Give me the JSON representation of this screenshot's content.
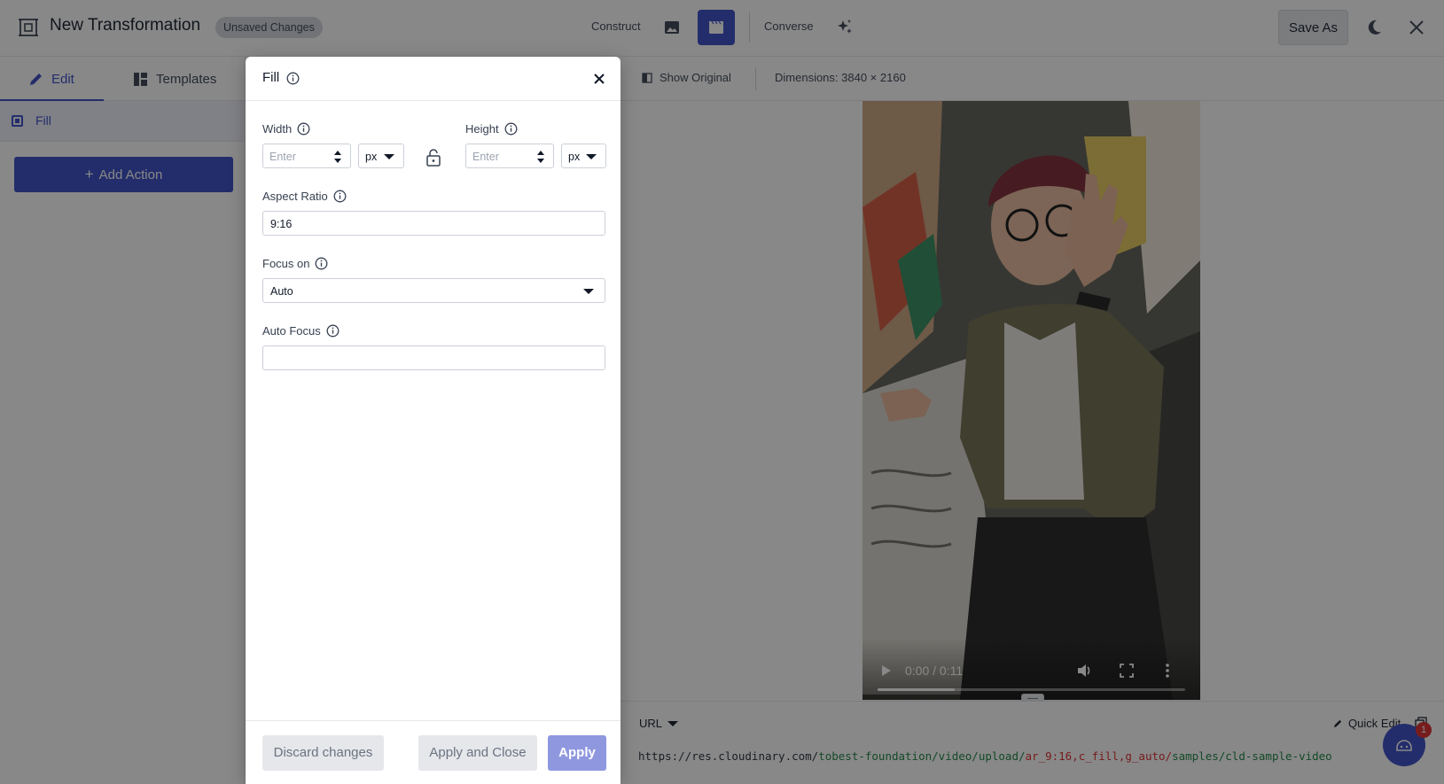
{
  "header": {
    "title": "New Transformation",
    "badge": "Unsaved Changes",
    "construct_label": "Construct",
    "converse_label": "Converse",
    "save_as_label": "Save As"
  },
  "left_panel": {
    "tabs": [
      {
        "label": "Edit",
        "active": true,
        "icon": "pencil-icon"
      },
      {
        "label": "Templates",
        "active": false,
        "icon": "grid-icon"
      }
    ],
    "actions": [
      {
        "label": "Fill"
      }
    ],
    "add_action_label": "Add Action"
  },
  "viewer": {
    "show_original_label": "Show Original",
    "dimensions": "Dimensions: 3840 × 2160",
    "video": {
      "time": "0:00 / 0:11",
      "progress_fraction": 0.25
    }
  },
  "url_bar": {
    "format_label": "URL",
    "quick_edit_label": "Quick Edit",
    "url_base": "https://res.cloudinary.com/",
    "url_cloud": "tobest-foundation/video/upload/",
    "url_transformation": "ar_9:16,c_fill,g_auto/",
    "url_public_id": "samples/cld-sample-video"
  },
  "chat": {
    "count": "1"
  },
  "dialog": {
    "title": "Fill",
    "width": {
      "label": "Width",
      "placeholder": "Enter",
      "unit": "px"
    },
    "height": {
      "label": "Height",
      "placeholder": "Enter",
      "unit": "px"
    },
    "aspect_ratio": {
      "label": "Aspect Ratio",
      "value": "9:16"
    },
    "focus_on": {
      "label": "Focus on",
      "value": "Auto"
    },
    "auto_focus": {
      "label": "Auto Focus",
      "value": ""
    },
    "buttons": {
      "discard": "Discard changes",
      "apply_close": "Apply and Close",
      "apply": "Apply"
    }
  },
  "colors": {
    "accent": "#3448c5",
    "apply_disabled": "#8f98df",
    "overlay": "rgba(17,17,17,0.5)"
  }
}
